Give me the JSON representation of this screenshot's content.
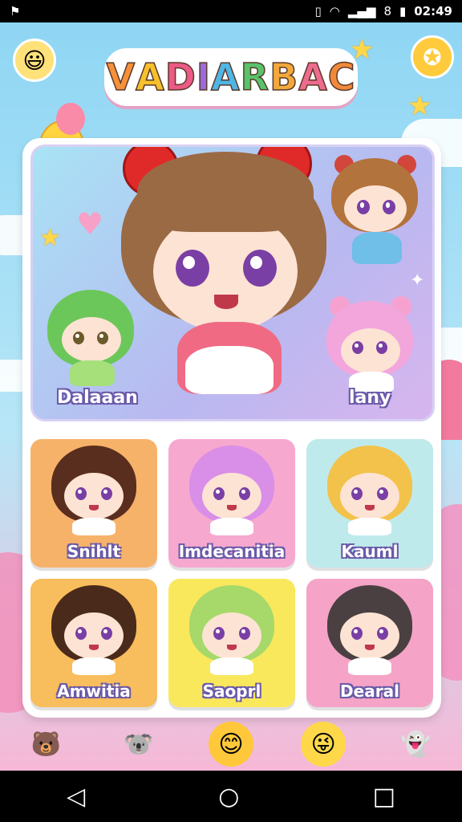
{
  "status": {
    "app_icon": "app-icon",
    "time": "02:49",
    "battery_digit": "8"
  },
  "title": {
    "letters": [
      {
        "ch": "V",
        "color": "#f7903a"
      },
      {
        "ch": "A",
        "color": "#f6c12c"
      },
      {
        "ch": "D",
        "color": "#ec5a86"
      },
      {
        "ch": "I",
        "color": "#9b6adf"
      },
      {
        "ch": "A",
        "color": "#4fb6e6"
      },
      {
        "ch": "R",
        "color": "#58c36b"
      },
      {
        "ch": "B",
        "color": "#f3a83b"
      },
      {
        "ch": "A",
        "color": "#ee6b8e"
      },
      {
        "ch": "C",
        "color": "#f0893a"
      }
    ]
  },
  "hero": {
    "left_label": "Dalaaan",
    "right_label": "lany"
  },
  "characters": [
    {
      "label": "Snihlt",
      "bg": "#f7b26a",
      "hair": "#5a2e1e"
    },
    {
      "label": "Imdecanitia",
      "bg": "#f6a8cf",
      "hair": "#d98ee8"
    },
    {
      "label": "Kauml",
      "bg": "#bfeaec",
      "hair": "#f2c24a"
    },
    {
      "label": "Amwitia",
      "bg": "#f8bd5c",
      "hair": "#4a2a1a"
    },
    {
      "label": "Saoprl",
      "bg": "#f9e85c",
      "hair": "#a6d86a"
    },
    {
      "label": "Dearal",
      "bg": "#f5a3c6",
      "hair": "#4a4042"
    }
  ],
  "bottom_nav": [
    {
      "name": "bear-icon",
      "glyph": "🐻"
    },
    {
      "name": "blue-bear-icon",
      "glyph": "🐨"
    },
    {
      "name": "home-face-icon",
      "glyph": "😊"
    },
    {
      "name": "smiley-icon",
      "glyph": "😜"
    },
    {
      "name": "ghost-icon",
      "glyph": "👻"
    }
  ],
  "system_nav": {
    "back": "◁",
    "home": "○",
    "recent": "□"
  }
}
